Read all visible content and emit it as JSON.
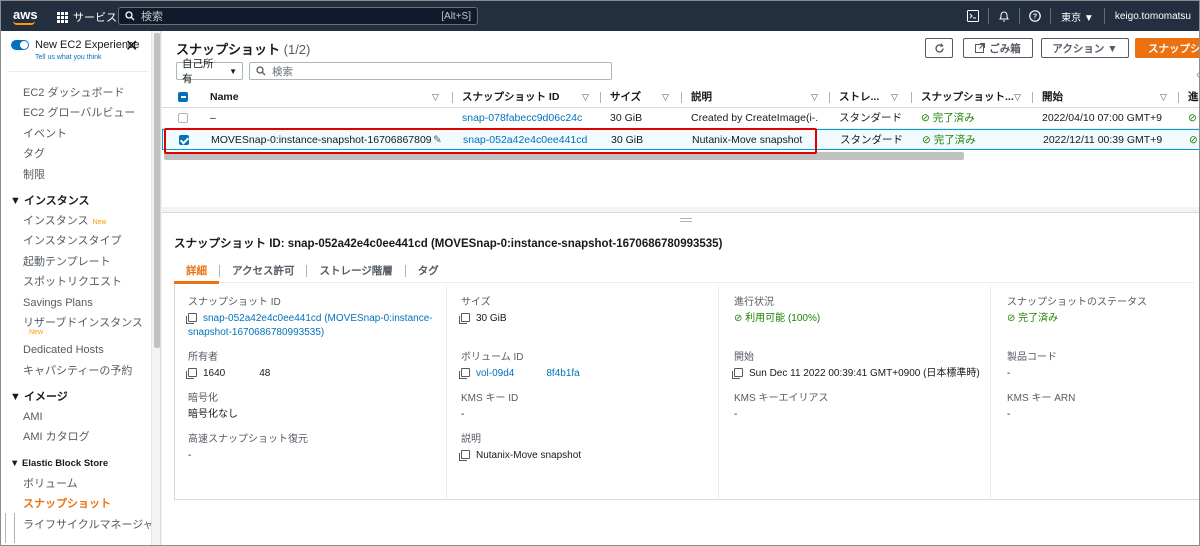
{
  "topbar": {
    "logo": "aws",
    "services_label": "サービス",
    "search_placeholder": "検索",
    "search_shortcut": "[Alt+S]",
    "region": "東京 ▼",
    "user": "keigo.tomomatsu"
  },
  "sidebar": {
    "new_experience": "New EC2 Experience",
    "tell_us": "Tell us what you think",
    "items": [
      {
        "type": "item",
        "label": "EC2 ダッシュボード"
      },
      {
        "type": "item",
        "label": "EC2 グローバルビュー"
      },
      {
        "type": "item",
        "label": "イベント"
      },
      {
        "type": "item",
        "label": "タグ"
      },
      {
        "type": "item",
        "label": "制限"
      },
      {
        "type": "group",
        "label": "▼ インスタンス"
      },
      {
        "type": "item",
        "label": "インスタンス",
        "badge": "New"
      },
      {
        "type": "item",
        "label": "インスタンスタイプ"
      },
      {
        "type": "item",
        "label": "起動テンプレート"
      },
      {
        "type": "item",
        "label": "スポットリクエスト"
      },
      {
        "type": "item",
        "label": "Savings Plans"
      },
      {
        "type": "item",
        "label": "リザーブドインスタンス"
      },
      {
        "type": "newline",
        "label": "New"
      },
      {
        "type": "item",
        "label": "Dedicated Hosts"
      },
      {
        "type": "item",
        "label": "キャパシティーの予約"
      },
      {
        "type": "group",
        "label": "▼ イメージ"
      },
      {
        "type": "item",
        "label": "AMI"
      },
      {
        "type": "item",
        "label": "AMI カタログ"
      },
      {
        "type": "group",
        "label": "▼ Elastic Block Store",
        "small": true
      },
      {
        "type": "item",
        "label": "ボリューム"
      },
      {
        "type": "item",
        "label": "スナップショット",
        "active": true
      },
      {
        "type": "item",
        "label": "ライフサイクルマネージャー"
      }
    ]
  },
  "list": {
    "title": "スナップショット",
    "count": "(1/2)",
    "refresh_icon": "C",
    "recycle_bin": "ごみ箱",
    "actions": "アクション ▼",
    "create": "スナップショ",
    "owner_filter": "自己所有",
    "search_placeholder": "検索",
    "columns": [
      "Name",
      "スナップショット ID",
      "サイズ",
      "説明",
      "ストレ...",
      "スナップショット...",
      "開始",
      "進"
    ],
    "rows": [
      {
        "name": "–",
        "id": "snap-078fabecc9d06c24c",
        "size": "30 GiB",
        "desc": "Created by CreateImage(i-...",
        "tier": "スタンダード",
        "status": "完了済み",
        "started": "2022/04/10 07:00 GMT+9",
        "selected": false
      },
      {
        "name": "MOVESnap-0:instance-snapshot-167068678099...",
        "id": "snap-052a42e4c0ee441cd",
        "size": "30 GiB",
        "desc": "Nutanix-Move snapshot",
        "tier": "スタンダード",
        "status": "完了済み",
        "started": "2022/12/11 00:39 GMT+9",
        "selected": true
      }
    ]
  },
  "detail": {
    "title": "スナップショット ID: snap-052a42e4c0ee441cd (MOVESnap-0:instance-snapshot-1670686780993535)",
    "tabs": [
      "詳細",
      "アクセス許可",
      "ストレージ階層",
      "タグ"
    ],
    "fields": {
      "snapshot_id_label": "スナップショット ID",
      "snapshot_id_value": "snap-052a42e4c0ee441cd (MOVESnap-0:instance-snapshot-1670686780993535)",
      "size_label": "サイズ",
      "size_value": "30 GiB",
      "progress_label": "進行状況",
      "progress_value": "利用可能 (100%)",
      "status_label": "スナップショットのステータス",
      "status_value": "完了済み",
      "owner_label": "所有者",
      "owner_value_a": "1640",
      "owner_value_b": "48",
      "volume_label": "ボリューム ID",
      "volume_value_a": "vol-09d4",
      "volume_value_b": "8f4b1fa",
      "started_label": "開始",
      "started_value": "Sun Dec 11 2022 00:39:41 GMT+0900 (日本標準時)",
      "product_code_label": "製品コード",
      "product_code_value": "-",
      "encryption_label": "暗号化",
      "encryption_value": "暗号化なし",
      "kms_key_id_label": "KMS キー ID",
      "kms_key_id_value": "-",
      "kms_alias_label": "KMS キーエイリアス",
      "kms_alias_value": "-",
      "kms_arn_label": "KMS キー ARN",
      "kms_arn_value": "-",
      "fast_restore_label": "高速スナップショット復元",
      "fast_restore_value": "-",
      "description_label": "説明",
      "description_value": "Nutanix-Move snapshot"
    }
  },
  "colors": {
    "topbar": "#232f3e",
    "accent": "#ec7211",
    "link": "#0073bb",
    "success": "#1d8102",
    "highlight": "#e00000"
  }
}
